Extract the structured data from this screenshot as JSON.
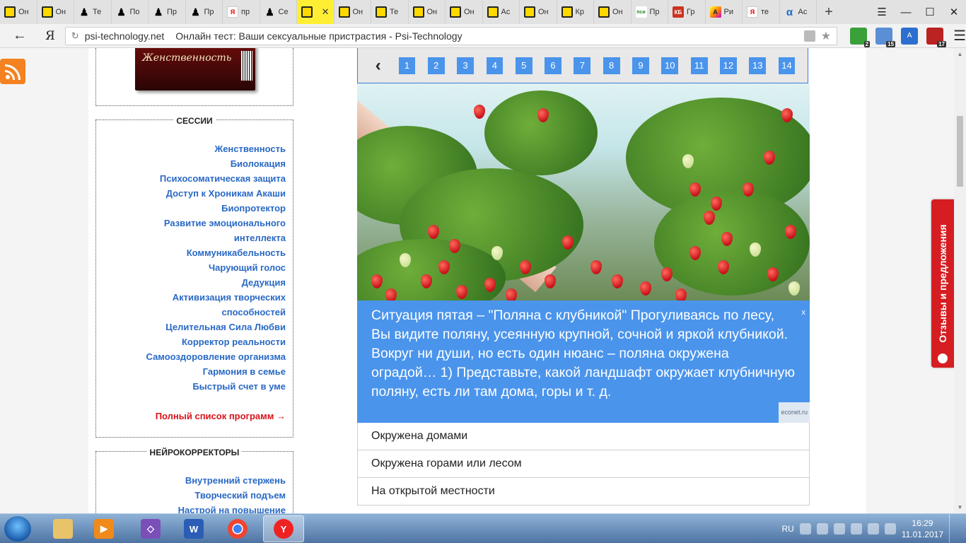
{
  "browser": {
    "tabs": [
      {
        "label": "Он",
        "icon": "hypnosis-icon"
      },
      {
        "label": "Он",
        "icon": "hypnosis-icon"
      },
      {
        "label": "Те",
        "icon": "silhouette-icon"
      },
      {
        "label": "По",
        "icon": "silhouette-icon"
      },
      {
        "label": "Пр",
        "icon": "silhouette-icon"
      },
      {
        "label": "Пр",
        "icon": "silhouette-icon"
      },
      {
        "label": "пр",
        "icon": "yandex-icon"
      },
      {
        "label": "Се",
        "icon": "silhouette-icon"
      },
      {
        "label": "",
        "icon": "hypnosis-icon",
        "active": true
      },
      {
        "label": "Он",
        "icon": "hypnosis-icon"
      },
      {
        "label": "Те",
        "icon": "hypnosis-icon"
      },
      {
        "label": "Он",
        "icon": "hypnosis-icon"
      },
      {
        "label": "Он",
        "icon": "hypnosis-icon"
      },
      {
        "label": "Ас",
        "icon": "hypnosis-icon"
      },
      {
        "label": "Он",
        "icon": "hypnosis-icon"
      },
      {
        "label": "Кр",
        "icon": "hypnosis-icon"
      },
      {
        "label": "Он",
        "icon": "hypnosis-icon"
      },
      {
        "label": "Пр",
        "icon": "psi-icon"
      },
      {
        "label": "Гр",
        "icon": "rb-icon"
      },
      {
        "label": "Ри",
        "icon": "art-icon"
      },
      {
        "label": "те",
        "icon": "yandex-icon"
      },
      {
        "label": "Ас",
        "icon": "alpha-icon"
      }
    ],
    "new_tab": "+",
    "window_controls": {
      "menu": "☰",
      "minimize": "—",
      "maximize": "☐",
      "close": "✕"
    },
    "back": "←",
    "yandex_logo": "Я",
    "domain": "psi-technology.net",
    "page_title": "Онлайн тест: Ваши сексуальные пристрастия - Psi-Technology",
    "extension_badges": [
      "2",
      "15",
      "17"
    ]
  },
  "sidebar": {
    "book_label": "Женственность",
    "sessions_title": "СЕССИИ",
    "sessions": [
      "Женственность",
      "Биолокация",
      "Психосоматическая защита",
      "Доступ к Хроникам Акаши",
      "Биопротектор",
      "Развитие эмоционального",
      "интеллекта",
      "Коммуникабельность",
      "Чарующий голос",
      "Дедукция",
      "Активизация творческих",
      "способностей",
      "Целительная Сила Любви",
      "Корректор реальности",
      "Самооздоровление организма",
      "Гармония в семье",
      "Быстрый счет в уме"
    ],
    "full_list": "Полный список программ →",
    "neuro_title": "НЕЙРОКОРРЕКТОРЫ",
    "neuro": [
      "Внутренний стержень",
      "Творческий подъем",
      "Настрой на повышение"
    ]
  },
  "quiz": {
    "prev": "‹",
    "pages": [
      "1",
      "2",
      "3",
      "4",
      "5",
      "6",
      "7",
      "8",
      "9",
      "10",
      "11",
      "12",
      "13",
      "14"
    ],
    "question": "Ситуация пятая – \"Поляна с клубникой\" Прогуливаясь по лесу, Вы видите поляну, усеянную крупной, сочной и яркой клубникой. Вокруг ни души, но есть один нюанс – поляна окружена оградой… 1) Представьте, какой ландшафт окружает клубничную поляну, есть ли там дома, горы и т. д.",
    "close": "x",
    "source": "econet.ru",
    "answers": [
      "Окружена домами",
      "Окружена горами или лесом",
      "На открытой местности"
    ]
  },
  "feedback": "Отзывы и предложения",
  "taskbar": {
    "apps": [
      "explorer-icon",
      "media-player-icon",
      "visual-studio-icon",
      "word-icon",
      "chrome-icon",
      "yandex-browser-icon"
    ],
    "lang": "RU",
    "time": "16:29",
    "date": "11.01.2017"
  },
  "colors": {
    "accent": "#4a94ec",
    "link": "#2a69c5",
    "red": "#d8141b",
    "active_tab": "#ffef34"
  }
}
